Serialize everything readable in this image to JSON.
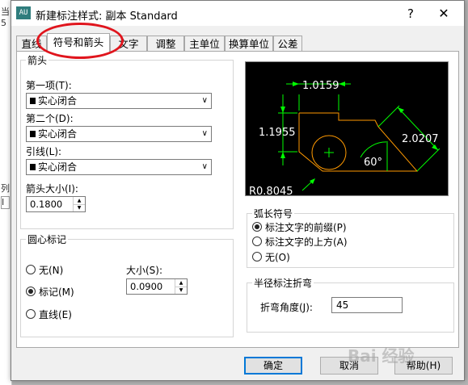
{
  "background_window": {
    "fragments": [
      "当",
      "5",
      "列",
      "I"
    ]
  },
  "dialog": {
    "icon_text": "AU",
    "title": "新建标注样式: 副本 Standard",
    "help_label": "?",
    "close_label": "✕"
  },
  "tabs": [
    {
      "label": "直线",
      "active": false
    },
    {
      "label": "符号和箭头",
      "active": true
    },
    {
      "label": "文字",
      "active": false
    },
    {
      "label": "调整",
      "active": false
    },
    {
      "label": "主单位",
      "active": false
    },
    {
      "label": "换算单位",
      "active": false
    },
    {
      "label": "公差",
      "active": false
    }
  ],
  "arrows": {
    "group_title": "箭头",
    "first_label": "第一项(T):",
    "first_value": "实心闭合",
    "second_label": "第二个(D):",
    "second_value": "实心闭合",
    "leader_label": "引线(L):",
    "leader_value": "实心闭合",
    "size_label": "箭头大小(I):",
    "size_value": "0.1800"
  },
  "center_marks": {
    "group_title": "圆心标记",
    "options": [
      {
        "label": "无(N)",
        "selected": false
      },
      {
        "label": "标记(M)",
        "selected": true
      },
      {
        "label": "直线(E)",
        "selected": false
      }
    ],
    "size_label": "大小(S):",
    "size_value": "0.0900"
  },
  "preview": {
    "dims": [
      "1.0159",
      "1.1955",
      "2.0207",
      "60°",
      "R0.8045"
    ],
    "colors": {
      "background": "#000000",
      "dimension": "#00ff00",
      "geometry": "#ff9900",
      "text": "#ffffff"
    }
  },
  "arc_length": {
    "group_title": "弧长符号",
    "options": [
      {
        "label": "标注文字的前缀(P)",
        "selected": true
      },
      {
        "label": "标注文字的上方(A)",
        "selected": false
      },
      {
        "label": "无(O)",
        "selected": false
      }
    ]
  },
  "radius_jog": {
    "group_title": "半径标注折弯",
    "angle_label": "折弯角度(J):",
    "angle_value": "45"
  },
  "buttons": {
    "ok": "确定",
    "cancel": "取消",
    "help": "帮助(H)"
  },
  "annotation": {
    "color": "#e0151d"
  },
  "watermark": "Bai 经验"
}
